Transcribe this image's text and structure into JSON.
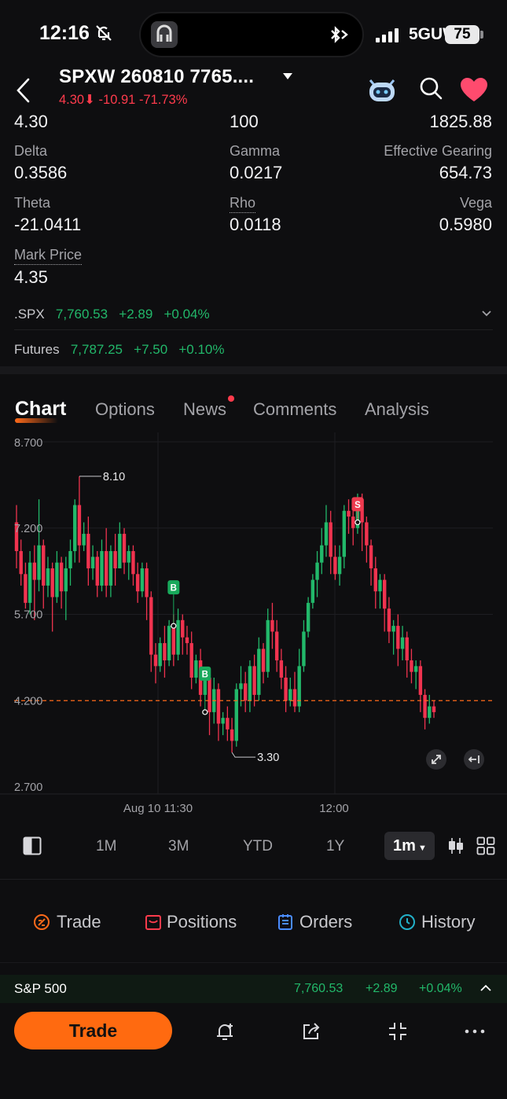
{
  "status_bar": {
    "time": "12:16",
    "network": "5GUW",
    "battery": "75"
  },
  "header": {
    "title": "SPXW 260810 7765....",
    "price": "4.30",
    "change": "-10.91",
    "change_pct": "-71.73%"
  },
  "metrics": {
    "row0": {
      "left": "4.30",
      "mid": "100",
      "right": "1825.88"
    },
    "delta": {
      "label": "Delta",
      "value": "0.3586"
    },
    "gamma": {
      "label": "Gamma",
      "value": "0.0217"
    },
    "gearing": {
      "label": "Effective Gearing",
      "value": "654.73"
    },
    "theta": {
      "label": "Theta",
      "value": "-21.0411"
    },
    "rho": {
      "label": "Rho",
      "value": "0.0118"
    },
    "vega": {
      "label": "Vega",
      "value": "0.5980"
    },
    "mark": {
      "label": "Mark Price",
      "value": "4.35"
    }
  },
  "quotes": [
    {
      "name": ".SPX",
      "price": "7,760.53",
      "change": "+2.89",
      "pct": "+0.04%"
    },
    {
      "name": "Futures",
      "price": "7,787.25",
      "change": "+7.50",
      "pct": "+0.10%"
    }
  ],
  "tabs": [
    "Chart",
    "Options",
    "News",
    "Comments",
    "Analysis"
  ],
  "chart_data": {
    "type": "candlestick",
    "ylim": [
      2.7,
      8.7
    ],
    "y_ticks": [
      "8.700",
      "7.200",
      "5.700",
      "4.200",
      "2.700"
    ],
    "x_ticks": [
      "Aug 10 11:30",
      "12:00"
    ],
    "high_label": "8.10",
    "low_label": "3.30",
    "current_line": 4.2,
    "markers": [
      "B",
      "B",
      "S"
    ],
    "candles": [
      [
        7.3,
        6.8,
        7.6,
        6.5
      ],
      [
        6.8,
        6.4,
        7.0,
        6.2
      ],
      [
        6.4,
        5.9,
        6.6,
        5.8
      ],
      [
        5.9,
        6.6,
        6.8,
        5.7
      ],
      [
        6.6,
        6.3,
        6.9,
        5.6
      ],
      [
        6.3,
        6.9,
        7.7,
        6.1
      ],
      [
        6.9,
        6.2,
        7.0,
        5.8
      ],
      [
        6.2,
        6.5,
        6.7,
        6.0
      ],
      [
        6.5,
        6.0,
        6.6,
        5.4
      ],
      [
        6.0,
        6.6,
        6.8,
        5.9
      ],
      [
        6.6,
        6.1,
        6.7,
        5.8
      ],
      [
        6.1,
        6.5,
        6.7,
        5.6
      ],
      [
        6.5,
        6.8,
        7.0,
        6.2
      ],
      [
        6.8,
        7.6,
        7.7,
        6.6
      ],
      [
        7.6,
        6.9,
        8.1,
        6.6
      ],
      [
        6.9,
        7.1,
        7.3,
        6.8
      ],
      [
        7.1,
        6.5,
        7.4,
        6.2
      ],
      [
        6.5,
        6.7,
        6.9,
        6.3
      ],
      [
        6.7,
        6.2,
        6.8,
        6.0
      ],
      [
        6.2,
        6.8,
        7.0,
        6.1
      ],
      [
        6.8,
        6.2,
        7.2,
        6.0
      ],
      [
        6.2,
        6.8,
        6.9,
        6.0
      ],
      [
        6.8,
        6.5,
        7.1,
        6.2
      ],
      [
        6.5,
        7.1,
        7.3,
        6.5
      ],
      [
        7.1,
        6.6,
        7.2,
        6.4
      ],
      [
        6.6,
        6.8,
        6.9,
        6.3
      ],
      [
        6.8,
        6.4,
        6.9,
        6.2
      ],
      [
        6.4,
        6.1,
        6.6,
        5.9
      ],
      [
        6.1,
        6.5,
        6.6,
        6.0
      ],
      [
        6.5,
        6.0,
        6.6,
        5.6
      ],
      [
        6.0,
        5.0,
        6.1,
        4.7
      ],
      [
        5.0,
        4.8,
        5.2,
        4.5
      ],
      [
        4.8,
        5.2,
        5.3,
        4.7
      ],
      [
        5.2,
        4.9,
        5.5,
        4.6
      ],
      [
        4.9,
        5.5,
        5.6,
        4.8
      ],
      [
        5.5,
        5.0,
        5.7,
        4.8
      ],
      [
        5.0,
        5.6,
        5.8,
        4.9
      ],
      [
        5.6,
        5.3,
        5.7,
        5.0
      ],
      [
        5.3,
        5.2,
        5.5,
        5.0
      ],
      [
        5.2,
        4.6,
        5.4,
        4.4
      ],
      [
        4.6,
        4.9,
        5.0,
        4.5
      ],
      [
        4.9,
        4.3,
        5.1,
        4.1
      ],
      [
        4.3,
        4.6,
        4.7,
        4.2
      ],
      [
        4.6,
        4.0,
        4.7,
        3.6
      ],
      [
        4.0,
        4.4,
        4.6,
        3.8
      ],
      [
        4.4,
        3.8,
        4.5,
        3.5
      ],
      [
        3.8,
        3.9,
        4.0,
        3.6
      ],
      [
        3.9,
        3.7,
        4.1,
        3.5
      ],
      [
        3.7,
        3.5,
        3.9,
        3.3
      ],
      [
        3.5,
        4.4,
        4.5,
        3.4
      ],
      [
        4.4,
        4.5,
        4.8,
        4.1
      ],
      [
        4.5,
        4.2,
        4.7,
        4.0
      ],
      [
        4.2,
        4.8,
        4.9,
        4.0
      ],
      [
        4.8,
        4.3,
        5.0,
        4.1
      ],
      [
        4.3,
        5.1,
        5.3,
        4.2
      ],
      [
        5.1,
        4.7,
        5.2,
        4.5
      ],
      [
        4.7,
        5.6,
        5.8,
        4.6
      ],
      [
        5.6,
        5.4,
        5.9,
        5.1
      ],
      [
        5.4,
        4.9,
        5.6,
        4.7
      ],
      [
        4.9,
        4.6,
        5.1,
        4.4
      ],
      [
        4.6,
        4.2,
        4.8,
        4.0
      ],
      [
        4.2,
        4.4,
        4.6,
        4.1
      ],
      [
        4.4,
        4.1,
        4.7,
        4.0
      ],
      [
        4.1,
        4.8,
        5.1,
        4.0
      ],
      [
        4.8,
        5.4,
        5.6,
        4.7
      ],
      [
        5.4,
        5.9,
        6.0,
        5.3
      ],
      [
        5.9,
        6.3,
        6.4,
        5.8
      ],
      [
        6.3,
        6.6,
        6.8,
        6.0
      ],
      [
        6.6,
        6.9,
        7.2,
        6.4
      ],
      [
        6.9,
        7.3,
        7.6,
        6.7
      ],
      [
        7.3,
        6.7,
        7.5,
        6.4
      ],
      [
        6.7,
        6.4,
        6.9,
        6.3
      ],
      [
        6.4,
        6.7,
        6.9,
        6.2
      ],
      [
        6.7,
        7.5,
        7.6,
        6.5
      ],
      [
        7.5,
        7.4,
        7.7,
        7.1
      ],
      [
        7.4,
        7.2,
        7.5,
        6.9
      ],
      [
        7.2,
        7.7,
        7.8,
        7.1
      ],
      [
        7.7,
        7.3,
        7.8,
        6.8
      ],
      [
        7.3,
        6.9,
        7.4,
        6.6
      ],
      [
        6.9,
        6.5,
        7.0,
        6.2
      ],
      [
        6.5,
        6.1,
        6.7,
        5.8
      ],
      [
        6.1,
        6.3,
        6.4,
        5.8
      ],
      [
        6.3,
        5.8,
        6.4,
        5.4
      ],
      [
        5.8,
        5.4,
        6.0,
        5.2
      ],
      [
        5.4,
        5.5,
        5.6,
        5.0
      ],
      [
        5.5,
        5.1,
        5.7,
        4.8
      ],
      [
        5.1,
        5.3,
        5.5,
        4.9
      ],
      [
        5.3,
        4.9,
        5.4,
        4.6
      ],
      [
        4.9,
        4.7,
        5.1,
        4.5
      ],
      [
        4.7,
        4.8,
        4.9,
        4.4
      ],
      [
        4.8,
        4.3,
        4.9,
        4.0
      ],
      [
        4.3,
        3.9,
        4.4,
        3.7
      ],
      [
        3.9,
        4.1,
        4.3,
        3.8
      ],
      [
        4.1,
        4.0,
        4.2,
        3.9
      ]
    ]
  },
  "periods": [
    "1M",
    "3M",
    "YTD",
    "1Y"
  ],
  "interval": "1m",
  "trade_tabs": [
    "Trade",
    "Positions",
    "Orders",
    "History"
  ],
  "footer_quote": {
    "name": "S&P 500",
    "price": "7,760.53",
    "change": "+2.89",
    "pct": "+0.04%"
  },
  "trade_button": "Trade"
}
